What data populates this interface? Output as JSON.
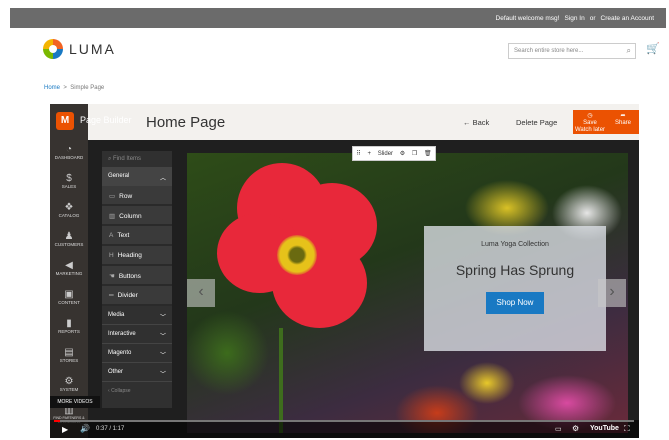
{
  "topbar": {
    "welcome": "Default welcome msg!",
    "signin": "Sign In",
    "or": "or",
    "create": "Create an Account"
  },
  "header": {
    "logo": "LUMA",
    "search_placeholder": "Search entire store here..."
  },
  "breadcrumb": {
    "home": "Home",
    "sep": ">",
    "current": "Simple Page"
  },
  "pagebuilder": {
    "label": "Page Builder",
    "title": "Home Page",
    "back": "← Back",
    "delete": "Delete Page",
    "save": "Save",
    "watch_later": "Watch later",
    "share": "Share"
  },
  "sidebar": {
    "items": [
      {
        "label": "Dashboard",
        "icon": "dashboard-icon"
      },
      {
        "label": "Sales",
        "icon": "dollar-icon"
      },
      {
        "label": "Catalog",
        "icon": "catalog-icon"
      },
      {
        "label": "Customers",
        "icon": "customers-icon"
      },
      {
        "label": "Marketing",
        "icon": "marketing-icon"
      },
      {
        "label": "Content",
        "icon": "content-icon"
      },
      {
        "label": "Reports",
        "icon": "reports-icon"
      },
      {
        "label": "Stores",
        "icon": "stores-icon"
      },
      {
        "label": "System",
        "icon": "system-icon"
      },
      {
        "label": "Find Partners & Extensions",
        "icon": "partners-icon"
      }
    ]
  },
  "panel": {
    "search_placeholder": "Find Items",
    "general": "General",
    "items": [
      "Row",
      "Column",
      "Text",
      "Heading",
      "Buttons",
      "Divider"
    ],
    "categories": [
      "Media",
      "Interactive",
      "Magento",
      "Other"
    ],
    "collapse": "Collapse"
  },
  "toolbar": {
    "label": "Slider"
  },
  "slide": {
    "collection": "Luma Yoga Collection",
    "heading": "Spring Has Sprung",
    "button": "Shop Now"
  },
  "video": {
    "more_videos": "MORE VIDEOS",
    "time": "0:37 / 1:17",
    "brand": "YouTube",
    "progress": 0.01
  }
}
